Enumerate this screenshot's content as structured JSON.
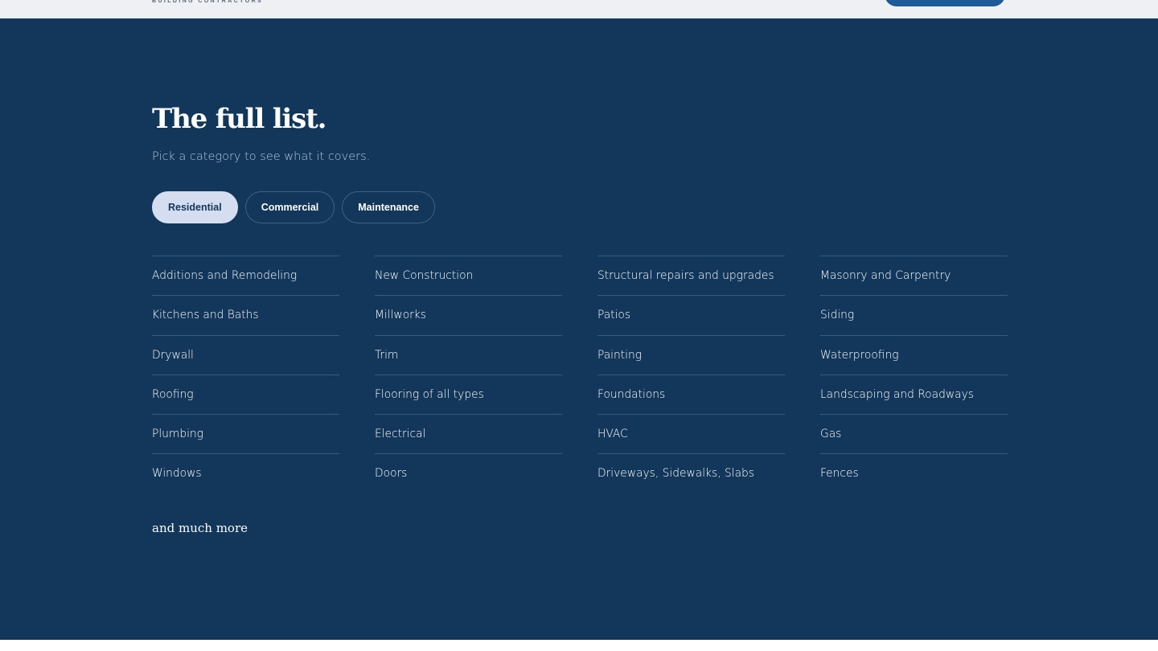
{
  "header": {
    "tagline": "BUILDING CONTRACTORS"
  },
  "section": {
    "title": "The full list.",
    "subtitle": "Pick a category to see what it covers.",
    "tabs": [
      {
        "label": "Residential",
        "active": true
      },
      {
        "label": "Commercial",
        "active": false
      },
      {
        "label": "Maintenance",
        "active": false
      }
    ],
    "columns": [
      [
        "Additions and Remodeling",
        "Kitchens and Baths",
        "Drywall",
        "Roofing",
        "Plumbing",
        "Windows"
      ],
      [
        "New Construction",
        "Millworks",
        "Trim",
        "Flooring of all types",
        "Electrical",
        "Doors"
      ],
      [
        "Structural repairs and upgrades",
        "Patios",
        "Painting",
        "Foundations",
        "HVAC",
        "Driveways, Sidewalks, Slabs"
      ],
      [
        "Masonry and Carpentry",
        "Siding",
        "Waterproofing",
        "Landscaping and Roadways",
        "Gas",
        "Fences"
      ]
    ],
    "more": "and much more"
  },
  "colors": {
    "section_bg": "#12375b",
    "tab_active_bg": "#d5def0",
    "cta_bg": "#1d5a97",
    "topbar_bg": "#eef0f3"
  }
}
